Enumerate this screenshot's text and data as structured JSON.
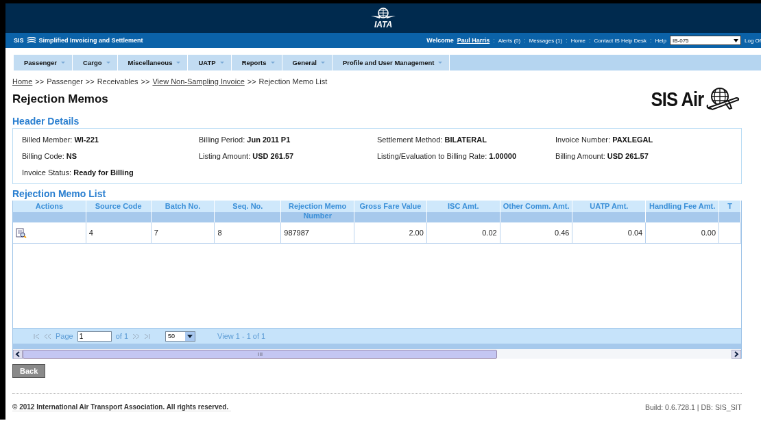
{
  "banner": {
    "logo_text": "IATA"
  },
  "app_bar": {
    "brand": "SIS",
    "title": "Simplified Invoicing and Settlement",
    "welcome": "Welcome",
    "user": "Paul Harris",
    "link_separator": ":",
    "links": [
      "Alerts (0)",
      "Messages (1)",
      "Home",
      "Contact IS Help Desk",
      "Help"
    ],
    "member_select": "IB-075",
    "logoff": "Log Of"
  },
  "menu": [
    "Passenger",
    "Cargo",
    "Miscellaneous",
    "UATP",
    "Reports",
    "General",
    "Profile and User Management"
  ],
  "breadcrumb": [
    {
      "text": "Home",
      "link": true
    },
    {
      "text": "Passenger",
      "link": false
    },
    {
      "text": "Receivables",
      "link": false
    },
    {
      "text": "View Non-Sampling Invoice",
      "link": true
    },
    {
      "text": "Rejection Memo List",
      "link": false
    }
  ],
  "breadcrumb_separator": ">>",
  "page_title": "Rejection Memos",
  "logo_text": "SIS Air",
  "header_details": {
    "title": "Header Details",
    "fields": [
      {
        "label": "Billed Member:",
        "value": "WI-221"
      },
      {
        "label": "Billing Period:",
        "value": "Jun 2011 P1"
      },
      {
        "label": "Settlement Method:",
        "value": "BILATERAL"
      },
      {
        "label": "Invoice Number:",
        "value": "PAXLEGAL"
      },
      {
        "label": "Billing Code:",
        "value": "NS"
      },
      {
        "label": "Listing Amount:",
        "value": "USD 261.57"
      },
      {
        "label": "Listing/Evaluation to Billing Rate:",
        "value": "1.00000"
      },
      {
        "label": "Billing Amount:",
        "value": "USD 261.57"
      },
      {
        "label": "Invoice Status:",
        "value": "Ready for Billing"
      }
    ]
  },
  "table": {
    "title": "Rejection Memo List",
    "columns": [
      "Actions",
      "Source Code",
      "Batch No.",
      "Seq. No.",
      "Rejection Memo Number",
      "Gross Fare Value",
      "ISC Amt.",
      "Other Comm. Amt.",
      "UATP Amt.",
      "Handling Fee Amt.",
      "T"
    ],
    "rows": [
      {
        "cells": [
          "",
          "4",
          "7",
          "8",
          "987987",
          "2.00",
          "0.02",
          "0.46",
          "0.04",
          "0.00",
          ""
        ]
      }
    ]
  },
  "pager": {
    "page_label": "Page",
    "page": "1",
    "of": "of 1",
    "page_size": "50",
    "view": "View 1 - 1 of 1"
  },
  "back_button": "Back",
  "footer": {
    "copyright": "© 2012 International Air Transport Association. All rights reserved.",
    "build": "Build: 0.6.728.1 | DB: SIS_SIT"
  }
}
